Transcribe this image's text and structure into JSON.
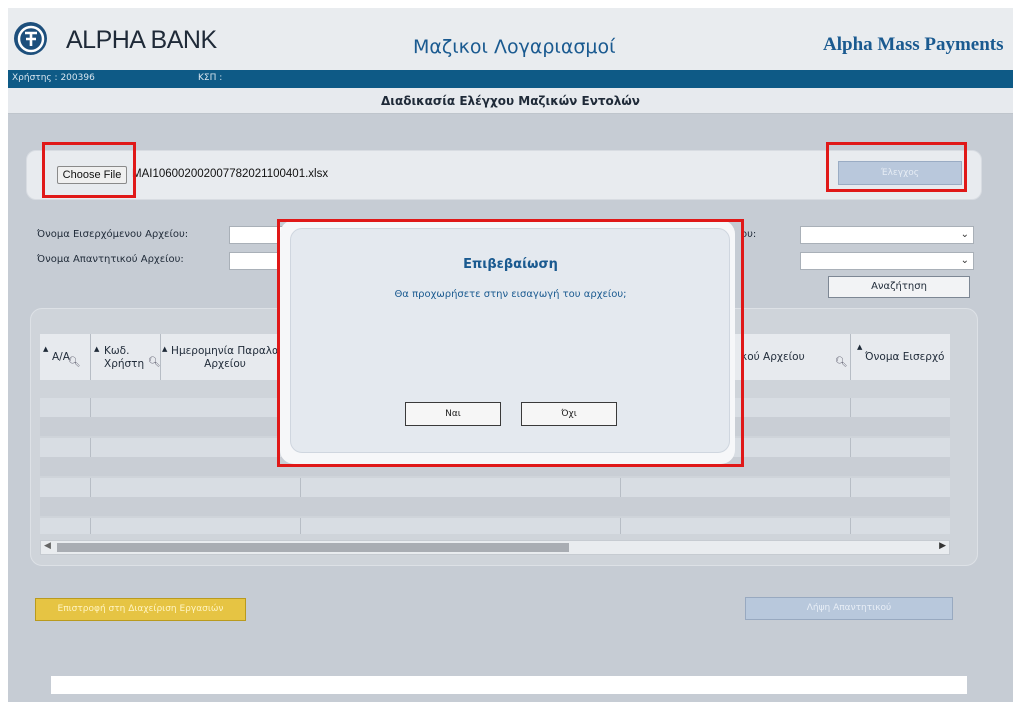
{
  "header": {
    "brand": "ALPHA BANK",
    "center_title": "Μαζικοι Λογαριασμοί",
    "right_title": "Alpha Mass Payments"
  },
  "userbar": {
    "user": "Χρήστης : 200396",
    "ksp": "ΚΣΠ :"
  },
  "page_title": "Διαδικασία Ελέγχου Μαζικών Εντολών",
  "upload": {
    "choose_label": "Choose File",
    "file_name": "MAI106002002007782021100401.xlsx",
    "check_label": "Έλεγχος"
  },
  "search": {
    "incoming_label": "Όνομα Εισερχόμενου Αρχείου:",
    "reply_label": "Όνομα Απαντητικού Αρχείου:",
    "right_label_partial": "ου:",
    "search_button": "Αναζήτηση"
  },
  "grid": {
    "columns": [
      "Α/Α",
      "Κωδ. Χρήστη",
      "Ημερομηνία Παραλα Αρχείου",
      "κού Αρχείου",
      "Όνομα Εισερχό"
    ]
  },
  "buttons": {
    "back": "Επιστροφή στη Διαχείριση Εργασιών",
    "download_reply": "Λήψη Απαντητικού"
  },
  "modal": {
    "title": "Επιβεβαίωση",
    "message": "Θα προχωρήσετε στην εισαγωγή του αρχείου;",
    "yes": "Ναι",
    "no": "Όχι"
  },
  "colors": {
    "brand_blue": "#1a5a90",
    "userbar": "#0e5a86",
    "highlight_red": "#e01818",
    "back_button": "#e6c443"
  }
}
